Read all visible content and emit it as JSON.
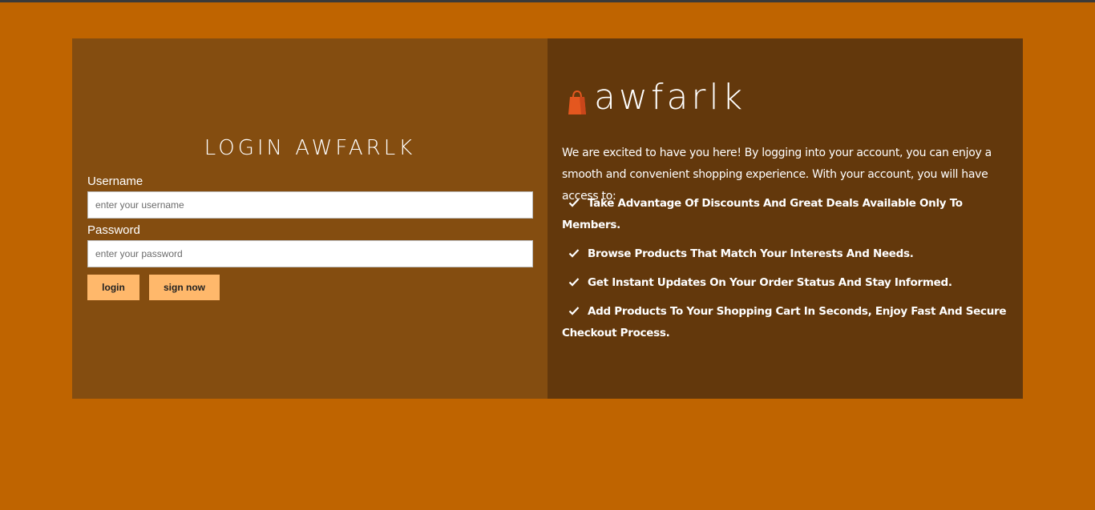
{
  "login": {
    "title": "LOGIN AWFARLK",
    "username_label": "Username",
    "username_placeholder": "enter your username",
    "password_label": "Password",
    "password_placeholder": "enter your password",
    "login_button": "login",
    "signup_button": "sign now"
  },
  "brand": {
    "name": "awfarlk",
    "icon": "shopping-bag-icon",
    "icon_color": "#e4571f"
  },
  "welcome": {
    "intro": "We are excited to have you here! By logging into your account, you can enjoy a smooth and convenient shopping experience. With your account, you will have access to:",
    "features": [
      "Take Advantage Of Discounts And Great Deals Available Only To Members.",
      "Browse Products That Match Your Interests And Needs.",
      "Get Instant Updates On Your Order Status And Stay Informed.",
      "Add Products To Your Shopping Cart In Seconds, Enjoy Fast And Secure Checkout Process."
    ]
  },
  "colors": {
    "page_bg": "#bf6400",
    "left_panel": "#844d10",
    "right_panel": "#63380c",
    "button_bg": "#ffb86b"
  }
}
